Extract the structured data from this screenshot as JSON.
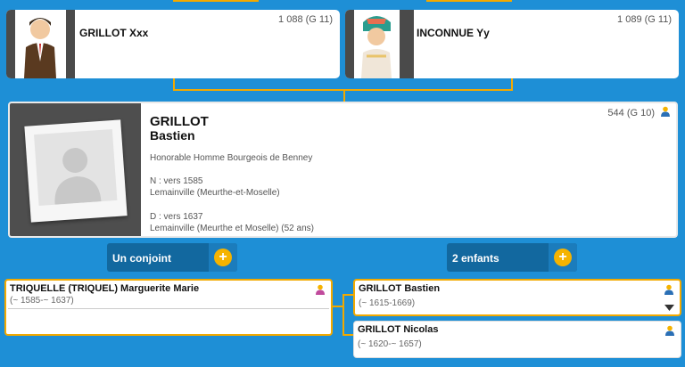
{
  "parents": [
    {
      "name": "GRILLOT Xxx",
      "sosa": "1 088 (G 11)"
    },
    {
      "name": "INCONNUE Yy",
      "sosa": "1 089 (G 11)"
    }
  ],
  "main": {
    "sosa": "544 (G 10)",
    "surname": "GRILLOT",
    "given": "Bastien",
    "occupation": "Honorable Homme Bourgeois de Benney",
    "birth": "N : vers 1585",
    "birth_place": "Lemainville (Meurthe-et-Moselle)",
    "death": "D : vers 1637",
    "death_place": "Lemainville (Meurthe et Moselle) (52 ans)"
  },
  "spouse_button": "Un conjoint",
  "children_button": "2 enfants",
  "spouse": {
    "name": "TRIQUELLE (TRIQUEL) Marguerite Marie",
    "dates": "(~ 1585-~ 1637)"
  },
  "children": [
    {
      "name": "GRILLOT Bastien",
      "dates": "(~ 1615-1669)"
    },
    {
      "name": "GRILLOT Nicolas",
      "dates": "(~ 1620-~ 1657)"
    }
  ],
  "colors": {
    "background": "#1e8fd6",
    "accent": "#f2a900",
    "male": "#2a6fb5",
    "female": "#c04a9c"
  }
}
